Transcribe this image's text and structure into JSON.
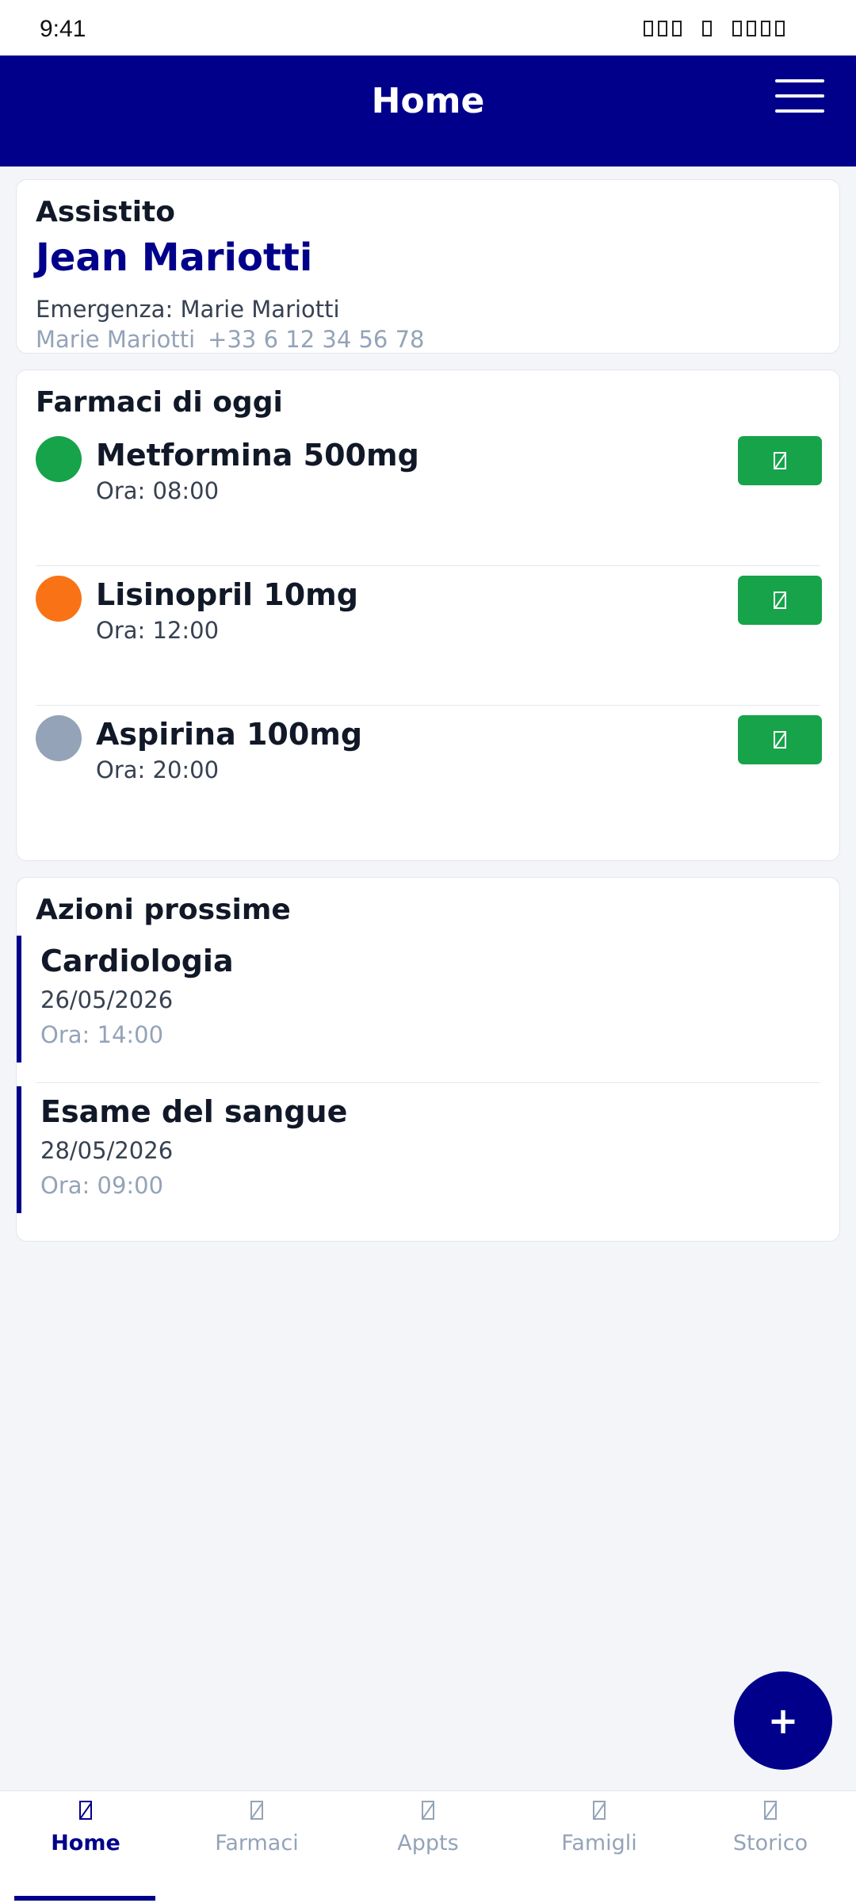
{
  "status_bar": {
    "time": "9:41"
  },
  "app_bar": {
    "title": "Home",
    "menu_icon": "hamburger-menu-icon"
  },
  "patient": {
    "section_label": "Assistito",
    "name": "Jean Mariotti",
    "emergency_label": "Emergenza: Marie Mariotti",
    "emergency_name": "Marie Mariotti",
    "emergency_phone": "+33 6 12 34 56 78"
  },
  "meds": {
    "title": "Farmaci di oggi",
    "items": [
      {
        "name": "Metformina 500mg",
        "time": "Ora: 08:00",
        "status_color": "#16a34a"
      },
      {
        "name": "Lisinopril 10mg",
        "time": "Ora: 12:00",
        "status_color": "#f97316"
      },
      {
        "name": "Aspirina 100mg",
        "time": "Ora: 20:00",
        "status_color": "#94a3b8"
      }
    ],
    "take_button_color": "#16a34a",
    "take_button_icon": "missing-glyph-icon"
  },
  "upcoming": {
    "title": "Azioni prossime",
    "items": [
      {
        "title": "Cardiologia",
        "date": "26/05/2026",
        "time": "Ora: 14:00"
      },
      {
        "title": "Esame del sangue",
        "date": "28/05/2026",
        "time": "Ora: 09:00"
      }
    ]
  },
  "fab": {
    "label": "+"
  },
  "bottom_nav": {
    "items": [
      {
        "label": "Home",
        "active": true
      },
      {
        "label": "Farmaci",
        "active": false
      },
      {
        "label": "Appts",
        "active": false
      },
      {
        "label": "Famigli",
        "active": false
      },
      {
        "label": "Storico",
        "active": false
      }
    ]
  },
  "colors": {
    "primary": "#00008b",
    "background": "#f3f5f9",
    "success": "#16a34a",
    "warning": "#f97316",
    "muted": "#94a3b8"
  }
}
